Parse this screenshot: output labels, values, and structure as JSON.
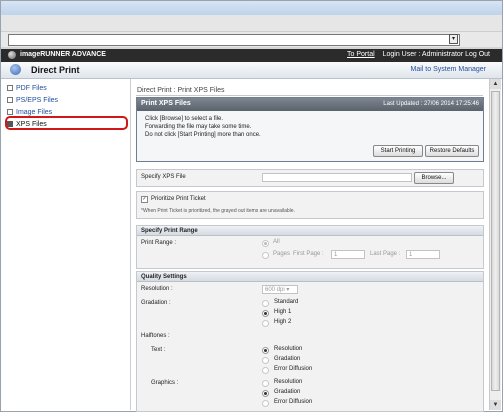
{
  "header": {
    "brand": "imageRUNNER ADVANCE",
    "portal_link": "To Portal",
    "login_info": "Login User : Administrator Log Out"
  },
  "subheader": {
    "title": "Direct Print",
    "mail_link": "Mail to System Manager"
  },
  "sidebar": {
    "items": [
      {
        "label": "PDF Files"
      },
      {
        "label": "PS/EPS Files"
      },
      {
        "label": "Image Files"
      },
      {
        "label": "XPS Files"
      }
    ]
  },
  "breadcrumb": "Direct Print : Print XPS Files",
  "xps_panel": {
    "title": "Print XPS Files",
    "last_updated": "Last Updated : 27/06 2014 17:25:46",
    "messages": [
      "Click [Browse] to select a file.",
      "Forwarding the file may take some time.",
      "Do not click [Start Printing] more than once."
    ],
    "start_button": "Start Printing",
    "defaults_button": "Restore Defaults"
  },
  "file_section": {
    "label": "Specify XPS File",
    "browse_button": "Browse..."
  },
  "ticket_section": {
    "checkbox_label": "Prioritize Print Ticket",
    "checked": true,
    "note": "*When Print Ticket is prioritized, the grayed out items are unavailable."
  },
  "print_range": {
    "heading": "Specify Print Range",
    "label": "Print Range :",
    "opt_all": "All",
    "opt_pages": "Pages",
    "first_page_label": "First Page :",
    "first_page_value": "1",
    "last_page_label": "Last Page :",
    "last_page_value": "1"
  },
  "quality": {
    "heading": "Quality Settings",
    "resolution_label": "Resolution :",
    "resolution_value": "600 dpi",
    "gradation_label": "Gradation :",
    "gradation_options": [
      "Standard",
      "High 1",
      "High 2"
    ],
    "halftones_label": "Halftones :",
    "text_label": "Text :",
    "text_options": [
      "Resolution",
      "Gradation",
      "Error Diffusion"
    ],
    "graphics_label": "Graphics :",
    "graphics_options": [
      "Resolution",
      "Gradation",
      "Error Diffusion"
    ]
  }
}
